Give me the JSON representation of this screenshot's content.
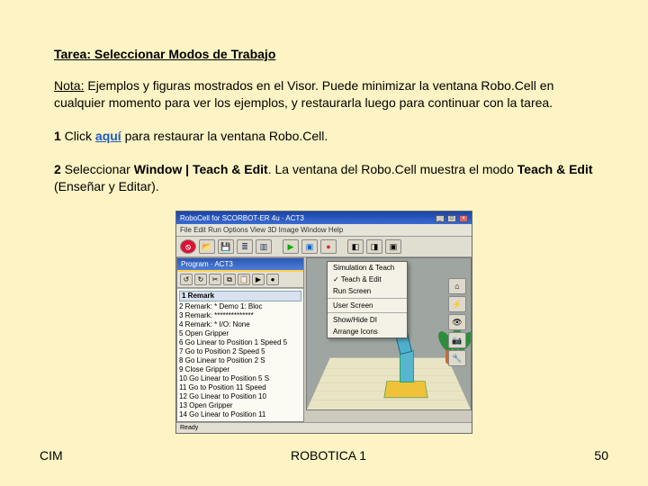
{
  "title": "Tarea: Seleccionar Modos de Trabajo",
  "nota_label": "Nota:",
  "nota_body": " Ejemplos y figuras mostrados en el Visor. Puede minimizar la ventana Robo.Cell en cualquier momento para ver los ejemplos, y restaurarla luego para continuar con la tarea.",
  "s1_a": "1",
  "s1_b": " Click ",
  "s1_link": "aquí",
  "s1_c": " para restaurar la ventana Robo.Cell.",
  "s2_a": "2",
  "s2_b": " Seleccionar ",
  "s2_c": "Window | Teach & Edit",
  "s2_d": ". La ventana del Robo.Cell muestra el modo ",
  "s2_e": "Teach & Edit",
  "s2_f": " (Enseñar y Editar).",
  "footer": {
    "left": "CIM",
    "center": "ROBOTICA 1",
    "right": "50"
  },
  "app": {
    "titlebar": "RoboCell for SCORBOT-ER 4u · ACT3",
    "menubar": "File  Edit  Run  Options  View  3D Image  Window  Help",
    "progtab": "Program · ACT3",
    "dropdown": {
      "i0": "Simulation & Teach",
      "i1": "Teach & Edit",
      "i2": "Run Screen",
      "i3": "User Screen",
      "i4": "Show/Hide DI",
      "i5": "Arrange Icons"
    },
    "program_header": "1  Remark",
    "program": [
      "2  Remark: * Demo 1: Bloc",
      "3  Remark: **************",
      "4  Remark: * I/O: None",
      "5  Open Gripper",
      "6  Go Linear to Position 1 Speed 5",
      "7  Go to Position 2 Speed 5",
      "8  Go Linear to Position 2 S",
      "9  Close Gripper",
      "10 Go Linear to Position 5 S",
      "11 Go to Position 11 Speed",
      "12 Go Linear to Position 10",
      "13 Open Gripper",
      "14 Go Linear to Position 11"
    ],
    "status_left": "Ready",
    "status_right": " "
  }
}
